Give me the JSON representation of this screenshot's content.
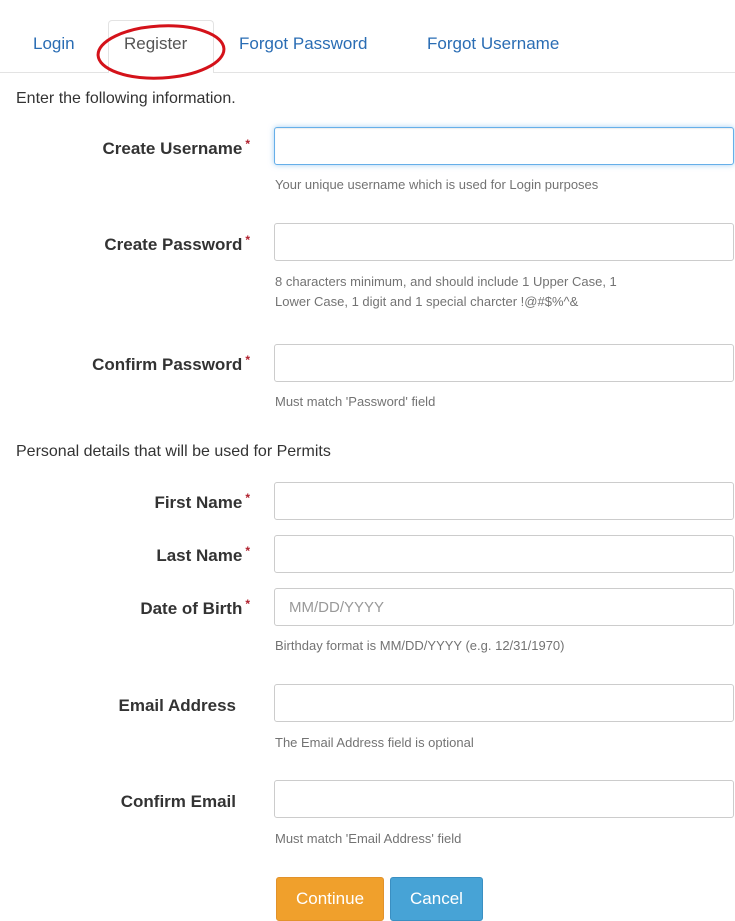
{
  "tabs": {
    "login": "Login",
    "register": "Register",
    "forgot_password": "Forgot Password",
    "forgot_username": "Forgot Username"
  },
  "account_section": {
    "intro": "Enter the following information.",
    "username": {
      "label": "Create Username",
      "required_mark": "*",
      "value": "",
      "help": "Your unique username which is used for Login purposes"
    },
    "password": {
      "label": "Create Password",
      "required_mark": "*",
      "value": "",
      "help_line1": "8 characters minimum, and should include 1 Upper Case, 1",
      "help_line2": "Lower Case, 1 digit and 1 special charcter !@#$%^&"
    },
    "confirm_password": {
      "label": "Confirm Password",
      "required_mark": "*",
      "value": "",
      "help": "Must match 'Password' field"
    }
  },
  "personal_section": {
    "intro": "Personal details that will be used for Permits",
    "first_name": {
      "label": "First Name",
      "required_mark": "*",
      "value": ""
    },
    "last_name": {
      "label": "Last Name",
      "required_mark": "*",
      "value": ""
    },
    "dob": {
      "label": "Date of Birth",
      "required_mark": "*",
      "value": "",
      "placeholder": "MM/DD/YYYY",
      "help": "Birthday format is MM/DD/YYYY (e.g. 12/31/1970)"
    },
    "email": {
      "label": "Email Address",
      "value": "",
      "help": "The Email Address field is optional"
    },
    "confirm_email": {
      "label": "Confirm Email",
      "value": "",
      "help": "Must match 'Email Address' field"
    }
  },
  "buttons": {
    "continue": "Continue",
    "cancel": "Cancel"
  },
  "colors": {
    "link": "#2a6db4",
    "required": "#b0202e",
    "continue_bg": "#f0a02c",
    "cancel_bg": "#47a3d6",
    "annotation_circle": "#d4121a"
  }
}
